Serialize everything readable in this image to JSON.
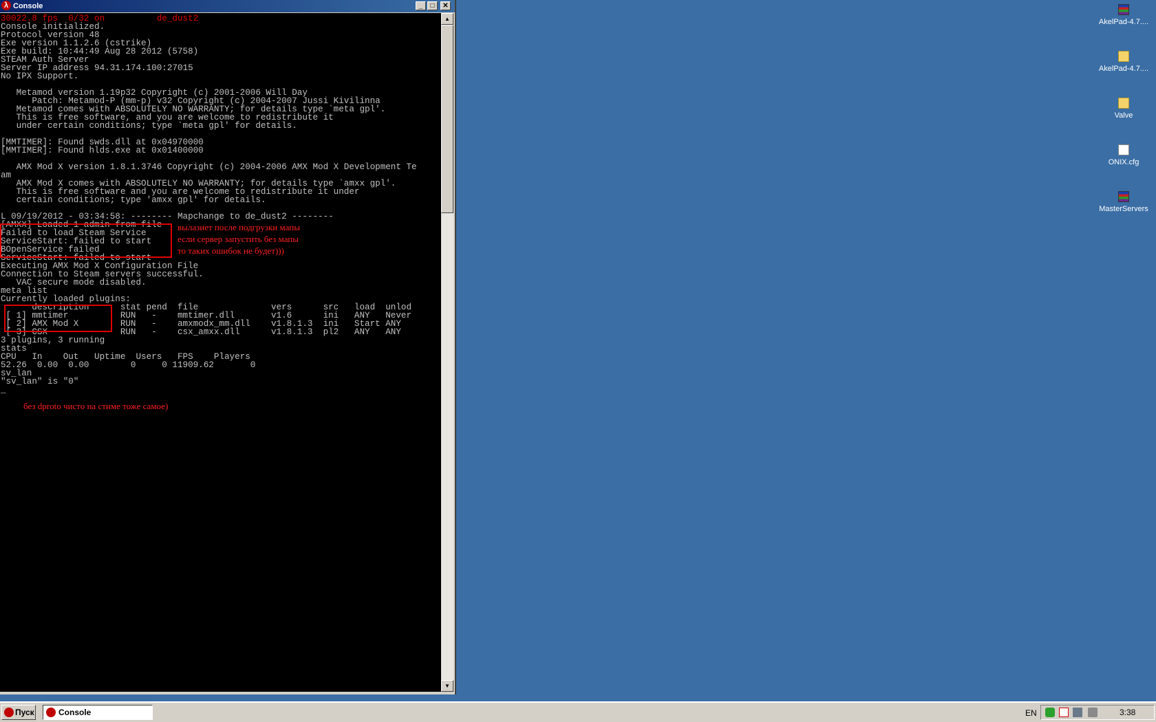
{
  "window": {
    "title": "Console",
    "icon": "half-life-lambda-icon",
    "minimize_icon": "minimize-icon",
    "maximize_icon": "maximize-icon",
    "close_icon": "close-icon",
    "minimize_glyph": "_",
    "maximize_glyph": "□",
    "close_glyph": "✕"
  },
  "console": {
    "status_line": "30022.8 fps  0/32 on          de_dust2",
    "lines": [
      "Console initialized.",
      "Protocol version 48",
      "Exe version 1.1.2.6 (cstrike)",
      "Exe build: 10:44:49 Aug 28 2012 (5758)",
      "STEAM Auth Server",
      "Server IP address 94.31.174.100:27015",
      "No IPX Support.",
      "",
      "   Metamod version 1.19p32 Copyright (c) 2001-2006 Will Day",
      "      Patch: Metamod-P (mm-p) v32 Copyright (c) 2004-2007 Jussi Kivilinna",
      "   Metamod comes with ABSOLUTELY NO WARRANTY; for details type `meta gpl'.",
      "   This is free software, and you are welcome to redistribute it",
      "   under certain conditions; type `meta gpl' for details.",
      "",
      "[MMTIMER]: Found swds.dll at 0x04970000",
      "[MMTIMER]: Found hlds.exe at 0x01400000",
      "",
      "   AMX Mod X version 1.8.1.3746 Copyright (c) 2004-2006 AMX Mod X Development Te",
      "am",
      "   AMX Mod X comes with ABSOLUTELY NO WARRANTY; for details type `amxx gpl'.",
      "   This is free software and you are welcome to redistribute it under",
      "   certain conditions; type 'amxx gpl' for details.",
      "",
      "L 09/19/2012 - 03:34:58: -------- Mapchange to de_dust2 --------",
      "[AMXX] Loaded 1 admin from file",
      "Failed to load Steam Service",
      "ServiceStart: failed to start",
      "BOpenService failed",
      "ServiceStart: failed to start",
      "Executing AMX Mod X Configuration File",
      "Connection to Steam servers successful.",
      "   VAC secure mode disabled.",
      "meta list",
      "Currently loaded plugins:",
      "      description      stat pend  file              vers      src   load  unlod",
      " [ 1] mmtimer          RUN   -    mmtimer.dll       v1.6      ini   ANY   Never",
      " [ 2] AMX Mod X        RUN   -    amxmodx_mm.dll    v1.8.1.3  ini   Start ANY",
      " [ 3] CSX              RUN   -    csx_amxx.dll      v1.8.1.3  pl2   ANY   ANY",
      "3 plugins, 3 running",
      "stats",
      "CPU   In    Out   Uptime  Users   FPS    Players",
      "52.26  0.00  0.00        0     0 11909.62       0",
      "sv_lan",
      "\"sv_lan\" is \"0\""
    ],
    "cursor": "_"
  },
  "annotations": {
    "note_1": "вылазиет после подгрузки мапы\nесли сервер запустить без мапы\nто таких ошибок не будет)))",
    "note_2": "без dproto чисто на стиме тоже самое)",
    "color": "#e00000"
  },
  "desktop_icons": [
    {
      "label": "AkelPad-4.7....",
      "icon": "winrar-archive-icon"
    },
    {
      "label": "AkelPad-4.7....",
      "icon": "folder-icon"
    },
    {
      "label": "Valve",
      "icon": "folder-icon"
    },
    {
      "label": "ONIX.cfg",
      "icon": "file-icon"
    },
    {
      "label": "MasterServers",
      "icon": "winrar-archive-icon"
    }
  ],
  "taskbar": {
    "start_label": "Пуск",
    "task_label": "Console",
    "language": "EN",
    "clock": "3:38"
  },
  "colors": {
    "desktop": "#3a6ea5",
    "titlebar": "#0a246a",
    "terminal_bg": "#000000",
    "terminal_text": "#c0c0c0"
  }
}
